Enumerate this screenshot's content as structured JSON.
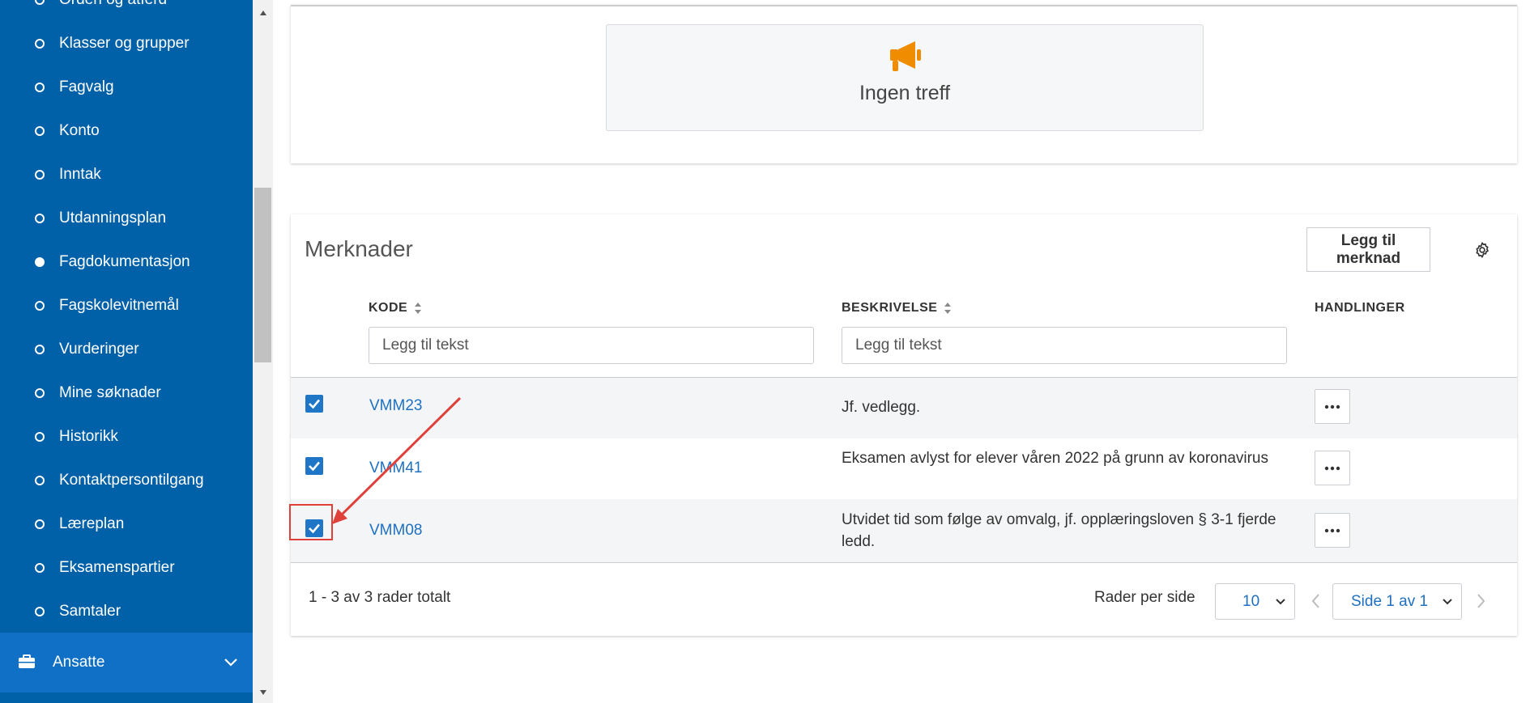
{
  "sidebar": {
    "items": [
      {
        "label": "Orden og atferd",
        "active": false
      },
      {
        "label": "Klasser og grupper",
        "active": false
      },
      {
        "label": "Fagvalg",
        "active": false
      },
      {
        "label": "Konto",
        "active": false
      },
      {
        "label": "Inntak",
        "active": false
      },
      {
        "label": "Utdanningsplan",
        "active": false
      },
      {
        "label": "Fagdokumentasjon",
        "active": true
      },
      {
        "label": "Fagskolevitnemål",
        "active": false
      },
      {
        "label": "Vurderinger",
        "active": false
      },
      {
        "label": "Mine søknader",
        "active": false
      },
      {
        "label": "Historikk",
        "active": false
      },
      {
        "label": "Kontaktpersontilgang",
        "active": false
      },
      {
        "label": "Læreplan",
        "active": false
      },
      {
        "label": "Eksamenspartier",
        "active": false
      },
      {
        "label": "Samtaler",
        "active": false
      }
    ],
    "section": {
      "label": "Ansatte",
      "icon": "briefcase-icon"
    }
  },
  "empty_state": {
    "text": "Ingen treff",
    "icon": "megaphone-icon"
  },
  "merknader": {
    "title": "Merknader",
    "add_button": "Legg til merknad",
    "columns": {
      "kode": "KODE",
      "beskrivelse": "BESKRIVELSE",
      "handlinger": "HANDLINGER"
    },
    "filters": {
      "kode_placeholder": "Legg til tekst",
      "beskrivelse_placeholder": "Legg til tekst"
    },
    "rows": [
      {
        "code": "VMM23",
        "description": "Jf. vedlegg.",
        "checked": true
      },
      {
        "code": "VMM41",
        "description": "Eksamen avlyst for elever våren 2022 på grunn av koronavirus",
        "checked": true
      },
      {
        "code": "VMM08",
        "description": "Utvidet tid som følge av omvalg, jf. opplæringsloven § 3-1 fjerde ledd.",
        "checked": true
      }
    ],
    "footer": {
      "count": "1 - 3 av 3 rader totalt",
      "rows_per_page_label": "Rader per side",
      "rows_per_page_value": "10",
      "page_value": "Side 1 av 1"
    }
  },
  "colors": {
    "sidebar": "#0060a8",
    "accent": "#1f75c6",
    "warning_icon": "#f08c00",
    "annotation": "#e0403a"
  }
}
